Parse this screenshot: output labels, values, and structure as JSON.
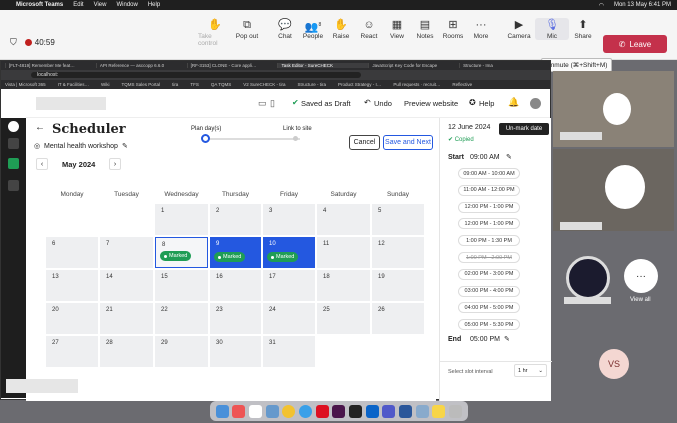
{
  "mac": {
    "app": "Microsoft Teams",
    "menus": [
      "Edit",
      "View",
      "Window",
      "Help"
    ],
    "clock": "Mon 13 May 6:41 PM"
  },
  "teams": {
    "timer": "40:59",
    "buttons": {
      "take_control": "Take control",
      "pop_out": "Pop out",
      "chat": "Chat",
      "people": "People",
      "people_count": "8",
      "raise": "Raise",
      "react": "React",
      "view": "View",
      "notes": "Notes",
      "rooms": "Rooms",
      "more": "More",
      "camera": "Camera",
      "mic": "Mic",
      "share": "Share"
    },
    "leave": "Leave",
    "tooltip": "Unmute (⌘+Shift+M)"
  },
  "browser": {
    "tabs": [
      "[FLT-4819] Remember Me feat…",
      "API Reference — asccopp 6.6.0",
      "[RF-3153] CLONE - Core appli…",
      "Task Editor - SureCHECK",
      "JavaScript Key Code for Escape",
      "Structure - Ima"
    ],
    "url": "localhost:",
    "bookmarks": [
      "Vista | Microsoft 365",
      "IT & Facilities…",
      "Wiki",
      "TQMS Sales Portal",
      "tira",
      "TFS",
      "QA TQMS",
      "V2 SureCHECK - tira",
      "Structure - tira",
      "Product Strategy - I…",
      "Pull requests · recruit…",
      "Reflective",
      "Vi…"
    ]
  },
  "header": {
    "saved": "Saved as Draft",
    "undo": "Undo",
    "preview": "Preview website",
    "help": "Help"
  },
  "scheduler": {
    "title": "Scheduler",
    "subtitle": "Mental health workshop",
    "month": "May 2024",
    "step1": "Plan day(s)",
    "step2": "Link to site",
    "cancel": "Cancel",
    "save_next": "Save and Next",
    "days": [
      "Monday",
      "Tuesday",
      "Wednesday",
      "Thursday",
      "Friday",
      "Saturday",
      "Sunday"
    ],
    "marked": "Marked",
    "dates": [
      "",
      "",
      "1",
      "2",
      "3",
      "4",
      "5",
      "6",
      "7",
      "8",
      "9",
      "10",
      "11",
      "12",
      "13",
      "14",
      "15",
      "16",
      "17",
      "18",
      "19",
      "20",
      "21",
      "22",
      "23",
      "24",
      "25",
      "26",
      "27",
      "28",
      "29",
      "30",
      "31",
      "",
      ""
    ]
  },
  "panel": {
    "date": "12 June 2024",
    "unmark": "Un-mark date",
    "copied": "Copied",
    "start_label": "Start",
    "start_time": "09:00 AM",
    "end_label": "End",
    "end_time": "05:00 PM",
    "interval_label": "Select slot interval",
    "interval": "1 hr",
    "slots": [
      "09:00 AM - 10:00 AM",
      "11:00 AM - 12:00 PM",
      "12:00 PM - 1:00 PM",
      "12:00 PM - 1:00 PM",
      "1:00 PM - 1:30 PM",
      "1:00 PM - 2:00 PM",
      "02:00 PM - 3:00 PM",
      "03:00 PM - 4:00 PM",
      "04:00 PM - 5:00 PM",
      "05:00 PM - 5:30 PM"
    ]
  },
  "people": {
    "view_all": "View all",
    "initials": "VS"
  }
}
